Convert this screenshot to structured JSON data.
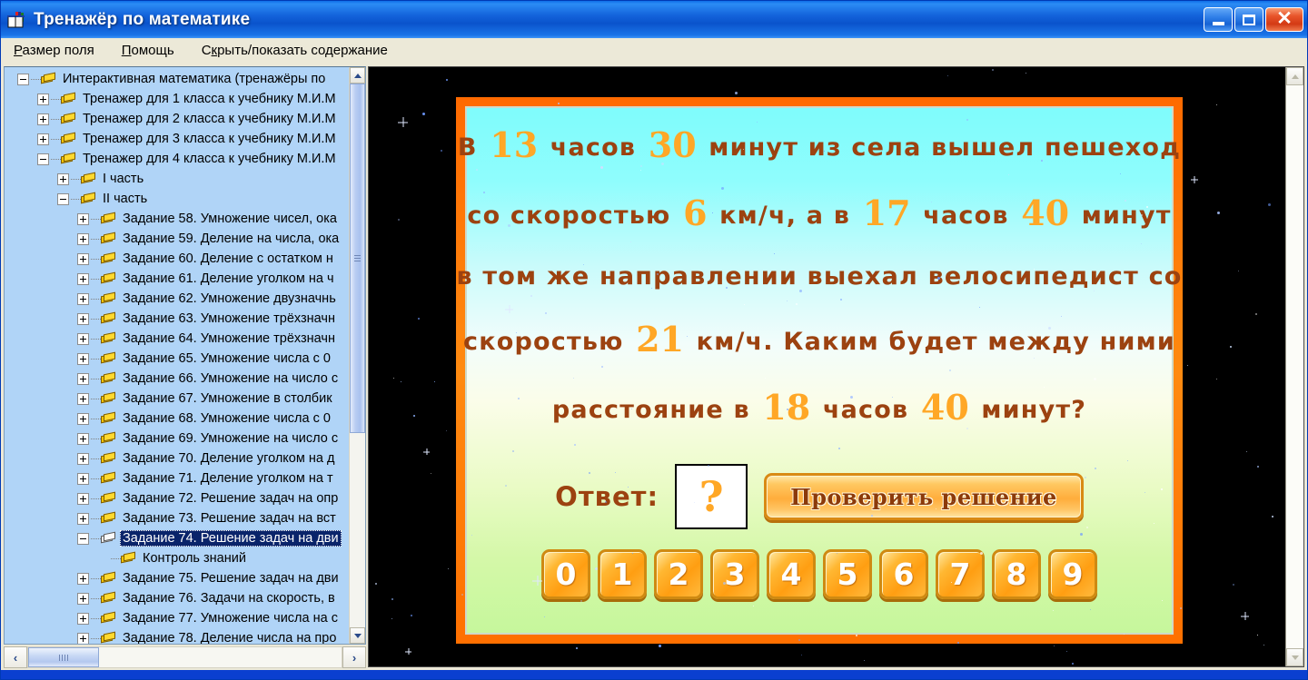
{
  "window": {
    "title": "Тренажёр по математике",
    "icon": "books-icon",
    "buttons": {
      "minimize": "minimize-icon",
      "maximize": "maximize-icon",
      "close": "close-icon"
    }
  },
  "menubar": {
    "items": [
      {
        "label": "Размер поля",
        "mnemonic": "Р"
      },
      {
        "label": "Помощь",
        "mnemonic": "П"
      },
      {
        "label": "Скрыть/показать содержание",
        "mnemonic": "к"
      }
    ]
  },
  "tree": {
    "nodes": [
      {
        "depth": 0,
        "toggle": "minus",
        "icon": "book-icon",
        "label": "Интерактивная математика (тренажёры по",
        "selected": false
      },
      {
        "depth": 1,
        "toggle": "plus",
        "icon": "book-icon",
        "label": "Тренажер для 1 класса к учебнику М.И.М",
        "selected": false
      },
      {
        "depth": 1,
        "toggle": "plus",
        "icon": "book-icon",
        "label": "Тренажер для 2 класса к учебнику М.И.М",
        "selected": false
      },
      {
        "depth": 1,
        "toggle": "plus",
        "icon": "book-icon",
        "label": "Тренажер для 3 класса к учебнику М.И.М",
        "selected": false
      },
      {
        "depth": 1,
        "toggle": "minus",
        "icon": "book-icon",
        "label": "Тренажер для 4 класса к учебнику М.И.М",
        "selected": false
      },
      {
        "depth": 2,
        "toggle": "plus",
        "icon": "book-icon",
        "label": "I часть",
        "selected": false
      },
      {
        "depth": 2,
        "toggle": "minus",
        "icon": "book-icon",
        "label": "II часть",
        "selected": false
      },
      {
        "depth": 3,
        "toggle": "plus",
        "icon": "book-icon",
        "label": "Задание 58. Умножение чисел, ока",
        "selected": false
      },
      {
        "depth": 3,
        "toggle": "plus",
        "icon": "book-icon",
        "label": "Задание 59. Деление на числа, ока",
        "selected": false
      },
      {
        "depth": 3,
        "toggle": "plus",
        "icon": "book-icon",
        "label": "Задание 60. Деление с остатком н",
        "selected": false
      },
      {
        "depth": 3,
        "toggle": "plus",
        "icon": "book-icon",
        "label": "Задание 61. Деление уголком на ч",
        "selected": false
      },
      {
        "depth": 3,
        "toggle": "plus",
        "icon": "book-icon",
        "label": "Задание 62. Умножение двузначнь",
        "selected": false
      },
      {
        "depth": 3,
        "toggle": "plus",
        "icon": "book-icon",
        "label": "Задание 63. Умножение трёхзначн",
        "selected": false
      },
      {
        "depth": 3,
        "toggle": "plus",
        "icon": "book-icon",
        "label": "Задание 64. Умножение трёхзначн",
        "selected": false
      },
      {
        "depth": 3,
        "toggle": "plus",
        "icon": "book-icon",
        "label": "Задание 65. Умножение числа с 0 ",
        "selected": false
      },
      {
        "depth": 3,
        "toggle": "plus",
        "icon": "book-icon",
        "label": "Задание 66. Умножение на число с",
        "selected": false
      },
      {
        "depth": 3,
        "toggle": "plus",
        "icon": "book-icon",
        "label": "Задание 67. Умножение в столбик",
        "selected": false
      },
      {
        "depth": 3,
        "toggle": "plus",
        "icon": "book-icon",
        "label": "Задание 68. Умножение числа с 0 ",
        "selected": false
      },
      {
        "depth": 3,
        "toggle": "plus",
        "icon": "book-icon",
        "label": "Задание 69. Умножение на число с",
        "selected": false
      },
      {
        "depth": 3,
        "toggle": "plus",
        "icon": "book-icon",
        "label": "Задание 70. Деление уголком на д",
        "selected": false
      },
      {
        "depth": 3,
        "toggle": "plus",
        "icon": "book-icon",
        "label": "Задание 71. Деление уголком на т",
        "selected": false
      },
      {
        "depth": 3,
        "toggle": "plus",
        "icon": "book-icon",
        "label": "Задание 72. Решение задач на опр",
        "selected": false
      },
      {
        "depth": 3,
        "toggle": "plus",
        "icon": "book-icon",
        "label": "Задание 73. Решение задач на вст",
        "selected": false
      },
      {
        "depth": 3,
        "toggle": "minus",
        "icon": "open-book-icon",
        "label": "Задание 74. Решение задач на дви",
        "selected": true
      },
      {
        "depth": 4,
        "toggle": "none",
        "icon": "book-icon",
        "label": "Контроль знаний",
        "selected": false
      },
      {
        "depth": 3,
        "toggle": "plus",
        "icon": "book-icon",
        "label": "Задание 75. Решение задач на дви",
        "selected": false
      },
      {
        "depth": 3,
        "toggle": "plus",
        "icon": "book-icon",
        "label": "Задание 76. Задачи на скорость, в",
        "selected": false
      },
      {
        "depth": 3,
        "toggle": "plus",
        "icon": "book-icon",
        "label": "Задание 77. Умножение числа на с",
        "selected": false
      },
      {
        "depth": 3,
        "toggle": "plus",
        "icon": "book-icon",
        "label": "Задание 78. Деление числа на про",
        "selected": false
      }
    ],
    "vscrollbar": {
      "up": "scroll-up-icon",
      "down": "scroll-down-icon"
    },
    "hscrollbar": {
      "left": "‹",
      "right": "›"
    }
  },
  "exercise": {
    "lines": [
      [
        {
          "t": "text",
          "v": "В"
        },
        {
          "t": "num",
          "v": "13"
        },
        {
          "t": "text",
          "v": "часов"
        },
        {
          "t": "num",
          "v": "30"
        },
        {
          "t": "text",
          "v": "минут из села вышел пешеход"
        }
      ],
      [
        {
          "t": "text",
          "v": "со скоростью"
        },
        {
          "t": "num",
          "v": "6"
        },
        {
          "t": "text",
          "v": "км/ч, а в"
        },
        {
          "t": "num",
          "v": "17"
        },
        {
          "t": "text",
          "v": "часов"
        },
        {
          "t": "num",
          "v": "40"
        },
        {
          "t": "text",
          "v": "минут"
        }
      ],
      [
        {
          "t": "text",
          "v": "в том же направлении выехал велосипедист со"
        }
      ],
      [
        {
          "t": "text",
          "v": "скоростью"
        },
        {
          "t": "num",
          "v": "21"
        },
        {
          "t": "text",
          "v": "км/ч. Каким будет между ними"
        }
      ],
      [
        {
          "t": "text",
          "v": "расстояние в"
        },
        {
          "t": "num",
          "v": "18"
        },
        {
          "t": "text",
          "v": "часов"
        },
        {
          "t": "num",
          "v": "40"
        },
        {
          "t": "text",
          "v": "минут?"
        }
      ]
    ],
    "answer_label": "Ответ:",
    "answer_value": "?",
    "check_button": "Проверить решение",
    "numpad": [
      "0",
      "1",
      "2",
      "3",
      "4",
      "5",
      "6",
      "7",
      "8",
      "9"
    ],
    "colors": {
      "text": "#9c4210",
      "number": "#ffa726",
      "card_border": "#ff6a00",
      "card_top": "#7ffcfc",
      "card_bottom": "#c6f79c"
    }
  },
  "stage_scrollbar": {
    "up": "scroll-up-icon",
    "down": "scroll-down-icon"
  }
}
